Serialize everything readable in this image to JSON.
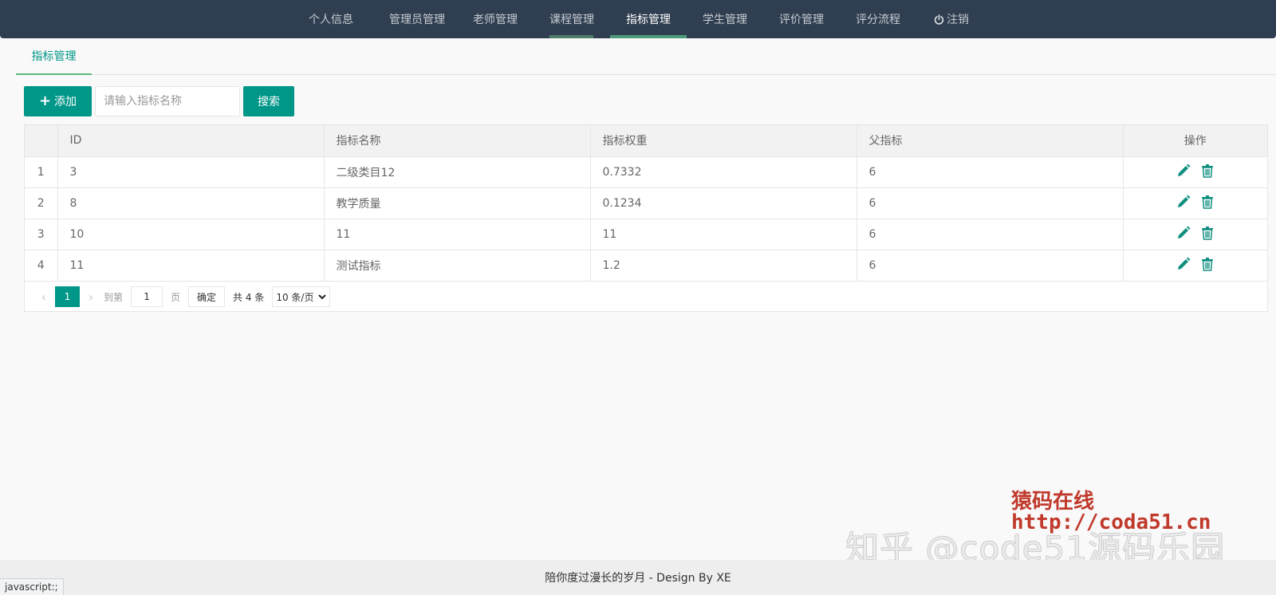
{
  "nav": {
    "items": [
      {
        "label": "个人信息"
      },
      {
        "label": "管理员管理"
      },
      {
        "label": "老师管理"
      },
      {
        "label": "课程管理"
      },
      {
        "label": "指标管理"
      },
      {
        "label": "学生管理"
      },
      {
        "label": "评价管理"
      },
      {
        "label": "评分流程"
      },
      {
        "label": "注销",
        "icon": "power-icon"
      }
    ],
    "active_index": 4,
    "colors": {
      "bg": "#2f3e50",
      "accent": "#4e9b7b"
    }
  },
  "tab": {
    "label": "指标管理"
  },
  "toolbar": {
    "add_label": "添加",
    "search_placeholder": "请输入指标名称",
    "search_label": "搜索"
  },
  "table": {
    "columns": [
      "",
      "ID",
      "指标名称",
      "指标权重",
      "父指标",
      "操作"
    ],
    "rows": [
      {
        "num": "1",
        "id": "3",
        "name": "二级类目12",
        "weight": "0.7332",
        "parent": "6"
      },
      {
        "num": "2",
        "id": "8",
        "name": "教学质量",
        "weight": "0.1234",
        "parent": "6"
      },
      {
        "num": "3",
        "id": "10",
        "name": "11",
        "weight": "11",
        "parent": "6"
      },
      {
        "num": "4",
        "id": "11",
        "name": "测试指标",
        "weight": "1.2",
        "parent": "6"
      }
    ],
    "row_icons": [
      "edit-icon",
      "delete-icon"
    ]
  },
  "pager": {
    "current": "1",
    "goto_label": "到第",
    "goto_value": "1",
    "page_unit": "页",
    "confirm_label": "确定",
    "total_label": "共 4 条",
    "per_page": "10 条/页"
  },
  "watermark": {
    "line1": "猿码在线",
    "line2": "http://coda51.cn",
    "zhihu": "知乎 @code51源码乐园"
  },
  "footer": {
    "text": "陪你度过漫长的岁月 - Design By XE"
  },
  "status_bar": {
    "text": "javascript:;"
  },
  "colors": {
    "primary": "#009688",
    "tab_underline": "#5fb878"
  }
}
